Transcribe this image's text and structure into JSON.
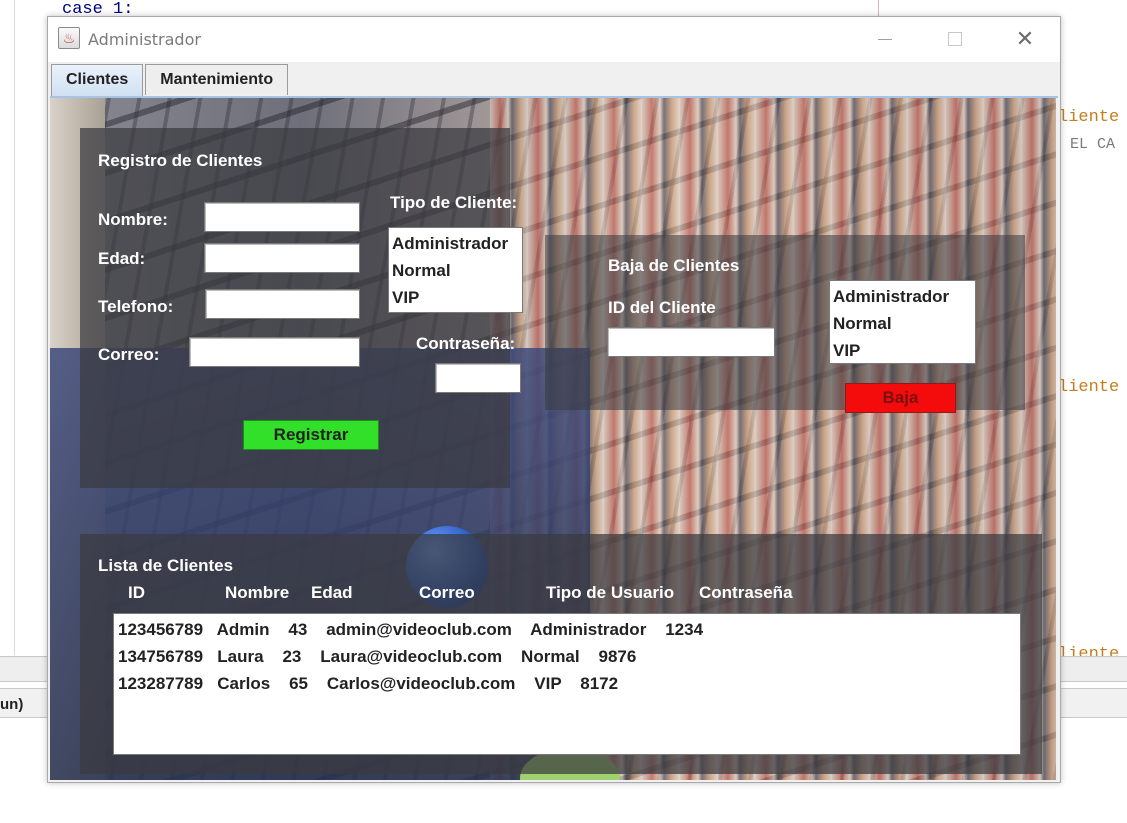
{
  "ide": {
    "code_line": "case 1:",
    "right_fragment_1": "liente",
    "right_fragment_2": "EL CA",
    "right_fragment_3": "liente",
    "right_fragment_4": "liente",
    "run_label": "un)"
  },
  "window": {
    "title": "Administrador",
    "icon": "java-cup-icon",
    "close_symbol": "✕"
  },
  "tabs": [
    {
      "label": "Clientes",
      "active": true
    },
    {
      "label": "Mantenimiento",
      "active": false
    }
  ],
  "registro": {
    "heading": "Registro de Clientes",
    "nombre_label": "Nombre:",
    "edad_label": "Edad:",
    "telefono_label": "Telefono:",
    "correo_label": "Correo:",
    "nombre_value": "",
    "edad_value": "",
    "telefono_value": "",
    "correo_value": "",
    "tipo_label": "Tipo de Cliente:",
    "tipo_options": [
      "Administrador",
      "Normal",
      "VIP"
    ],
    "password_label": "Contraseña:",
    "password_value": "",
    "register_button": "Registrar",
    "register_color": "#32e02a"
  },
  "baja": {
    "heading": "Baja de Clientes",
    "id_label": "ID del Cliente",
    "id_value": "",
    "tipo_options": [
      "Administrador",
      "Normal",
      "VIP"
    ],
    "baja_button": "Baja",
    "baja_color": "#f40b0b"
  },
  "lista": {
    "heading": "Lista de Clientes",
    "columns": [
      "ID",
      "Nombre",
      "Edad",
      "Correo",
      "Tipo de Usuario",
      "Contraseña"
    ],
    "rows": [
      "123456789   Admin    43    admin@videoclub.com    Administrador    1234",
      "134756789   Laura    23    Laura@videoclub.com    Normal    9876",
      "123287789   Carlos    65    Carlos@videoclub.com    VIP    8172"
    ]
  }
}
